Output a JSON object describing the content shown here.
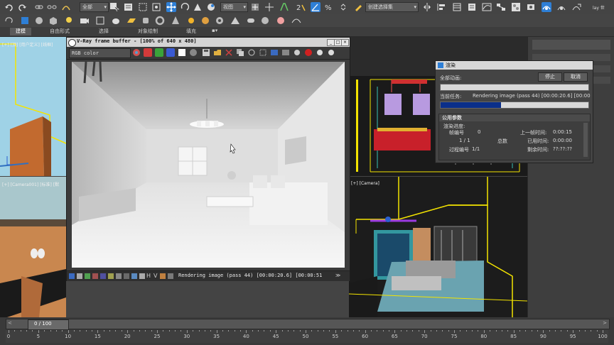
{
  "toolbar": {
    "selection_filter": "全部",
    "ref_coord": "视图",
    "named_selection": "创建选择集",
    "user_label": "lay 世"
  },
  "ribbon": {
    "tabs": [
      "建模",
      "自由形式",
      "选择",
      "对象绘制",
      "填充"
    ]
  },
  "viewports": {
    "top_left_label": "[+] [顶] [用户定义] [线框]",
    "bottom_left_label": "[+] [Camera001] [标准] [默",
    "bottom_right_label": "[+] [Camera]"
  },
  "vfb": {
    "title": "V-Ray frame buffer - [100% of 640 x 480]",
    "channel": "RGB color",
    "status": "Rendering image (pass 44) [00:00:20.6] [00:00:51"
  },
  "render_dialog": {
    "title": "渲染",
    "overall_progress_label": "全部动画:",
    "pause_button": "停止",
    "cancel_button": "取消",
    "current_task_label": "当前任务:",
    "current_task_value": "Rendering image (pass 44) [00:00:20.6] [00:00:",
    "overall_progress": 0,
    "task_progress": 0.41,
    "common_params_label": "公用参数",
    "render_progress_label": "渲染进度:",
    "frame_number_label": "帧编号",
    "frame_number_value": "0",
    "frame_count_value": "1 / 1",
    "total_label": "总数",
    "process_label": "过程编号",
    "process_value": "1/1",
    "last_frame_time_label": "上一帧时间:",
    "last_frame_time_value": "0:00:15",
    "elapsed_label": "已用时间:",
    "elapsed_value": "0:00:00",
    "remaining_label": "剩余时间:",
    "remaining_value": "??:??:??"
  },
  "timeline": {
    "frame_counter": "0 / 100",
    "ticks": [
      "0",
      "5",
      "10",
      "15",
      "20",
      "25",
      "30",
      "35",
      "40",
      "45",
      "50",
      "55",
      "60",
      "65",
      "70",
      "75",
      "80",
      "85",
      "90",
      "95",
      "100"
    ]
  },
  "colors": {
    "ui_bg": "#444444",
    "accent_blue": "#2e7fd6",
    "progress_fill": "#0a2f8a",
    "viewport_wire_yellow": "#f4e400"
  }
}
